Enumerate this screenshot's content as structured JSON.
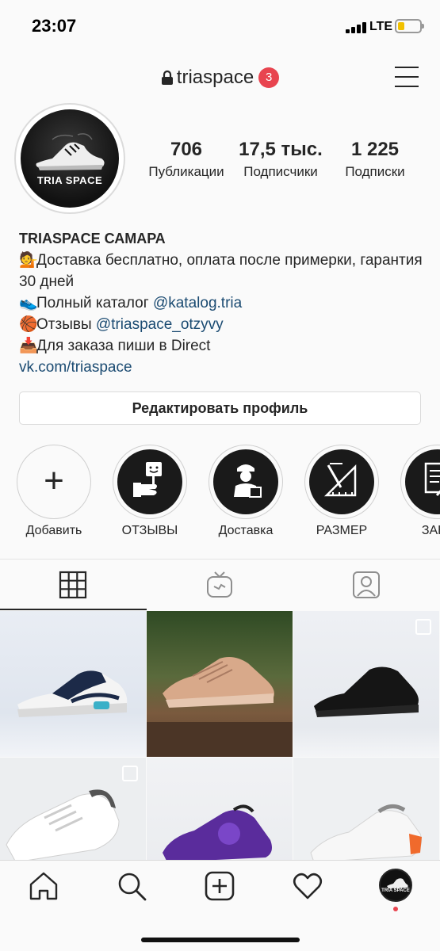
{
  "status_bar": {
    "time": "23:07",
    "network": "LTE",
    "battery_level": 0.3
  },
  "header": {
    "username": "triaspace",
    "notification_count": "3",
    "lock_icon": "lock-icon",
    "menu_icon": "hamburger-icon"
  },
  "profile": {
    "avatar_text": "TRIA SPACE",
    "stats": [
      {
        "value": "706",
        "label": "Публикации"
      },
      {
        "value": "17,5 тыс.",
        "label": "Подписчики"
      },
      {
        "value": "1 225",
        "label": "Подписки"
      }
    ],
    "name": "TRIASPACE САМАРА",
    "bio": {
      "line1_emoji": "💁",
      "line1": "Доставка бесплатно, оплата после примерки, гарантия 30 дней",
      "line2_emoji": "👟",
      "line2_text": "Полный каталог ",
      "line2_link": "@katalog.tria",
      "line3_emoji": "🏀",
      "line3_text": "Отзывы ",
      "line3_link": "@triaspace_otzyvy",
      "line4_emoji": "📥",
      "line4": "Для заказа пиши в Direct",
      "website": "vk.com/triaspace"
    },
    "edit_button": "Редактировать профиль"
  },
  "highlights": [
    {
      "label": "Добавить",
      "icon": "plus-icon"
    },
    {
      "label": "ОТЗЫВЫ",
      "icon": "review-sign-icon"
    },
    {
      "label": "Доставка",
      "icon": "courier-icon"
    },
    {
      "label": "РАЗМЕР",
      "icon": "ruler-icon"
    },
    {
      "label": "ЗАКА",
      "icon": "order-form-icon"
    }
  ],
  "tabs": [
    {
      "name": "grid",
      "icon": "grid-icon",
      "active": true
    },
    {
      "name": "igtv",
      "icon": "igtv-icon",
      "active": false
    },
    {
      "name": "tagged",
      "icon": "tagged-person-icon",
      "active": false
    }
  ],
  "posts": [
    {
      "subject": "navy-white-sneaker",
      "multi": false
    },
    {
      "subject": "beige-knit-sneaker",
      "multi": false
    },
    {
      "subject": "black-sneaker",
      "multi": true
    },
    {
      "subject": "white-sneaker",
      "multi": true
    },
    {
      "subject": "purple-sneaker",
      "multi": false
    },
    {
      "subject": "white-orange-sneaker",
      "multi": false
    }
  ],
  "bottom_nav": [
    {
      "name": "home",
      "icon": "home-icon"
    },
    {
      "name": "search",
      "icon": "search-icon"
    },
    {
      "name": "new-post",
      "icon": "add-post-icon"
    },
    {
      "name": "activity",
      "icon": "heart-icon"
    },
    {
      "name": "profile",
      "icon": "profile-avatar-icon"
    }
  ],
  "colors": {
    "accent_link": "#1b4b72",
    "badge": "#e8444f",
    "text": "#262626"
  }
}
